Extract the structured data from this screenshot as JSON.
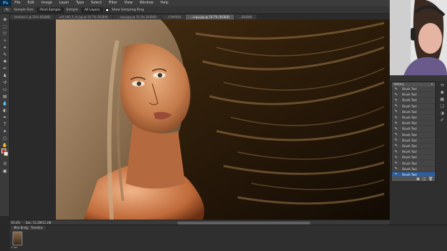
{
  "app": {
    "logo": "Ps",
    "menus": [
      "File",
      "Edit",
      "Image",
      "Layer",
      "Type",
      "Select",
      "Filter",
      "View",
      "Window",
      "Help"
    ]
  },
  "options": {
    "sample_size_label": "Sample Size:",
    "sample_size_value": "Point Sample",
    "sample_label": "Sample:",
    "sample_value": "All Layers",
    "show_ring_label": "Show Sampling Ring"
  },
  "tabs": [
    {
      "label": "Untitled-1 @ 25% (RGB/8)",
      "active": false
    },
    {
      "label": "sdf_h00_5_Ai.jpg @ 16.7% (RGB/8)",
      "active": false
    },
    {
      "label": "...copy.jpg @ 33.3% (RGB/8)",
      "active": false
    },
    {
      "label": "...(CMYK/8)",
      "active": false
    },
    {
      "label": "...copy.jpg @ 16.7% (RGB/8)",
      "active": true
    },
    {
      "label": "...(RGB/8)",
      "active": false
    }
  ],
  "status": {
    "zoom": "95.6%",
    "doc": "Doc: 11.2M/11.2M"
  },
  "bottom_panel": {
    "tabs": [
      "Mini Bridge",
      "Timeline"
    ],
    "thumb_label": "0 sec"
  },
  "history": {
    "title": "History",
    "items": [
      "Brush Tool",
      "Brush Tool",
      "Brush Tool",
      "Brush Tool",
      "Brush Tool",
      "Brush Tool",
      "Brush Tool",
      "Brush Tool",
      "Brush Tool",
      "Brush Tool",
      "Brush Tool",
      "Brush Tool",
      "Brush Tool",
      "Brush Tool",
      "Brush Tool",
      "Brush Tool"
    ],
    "selected_index": 15
  },
  "colors": {
    "foreground": "#c0392b",
    "background": "#f0e6d8",
    "selection": "#2c5fa0"
  }
}
